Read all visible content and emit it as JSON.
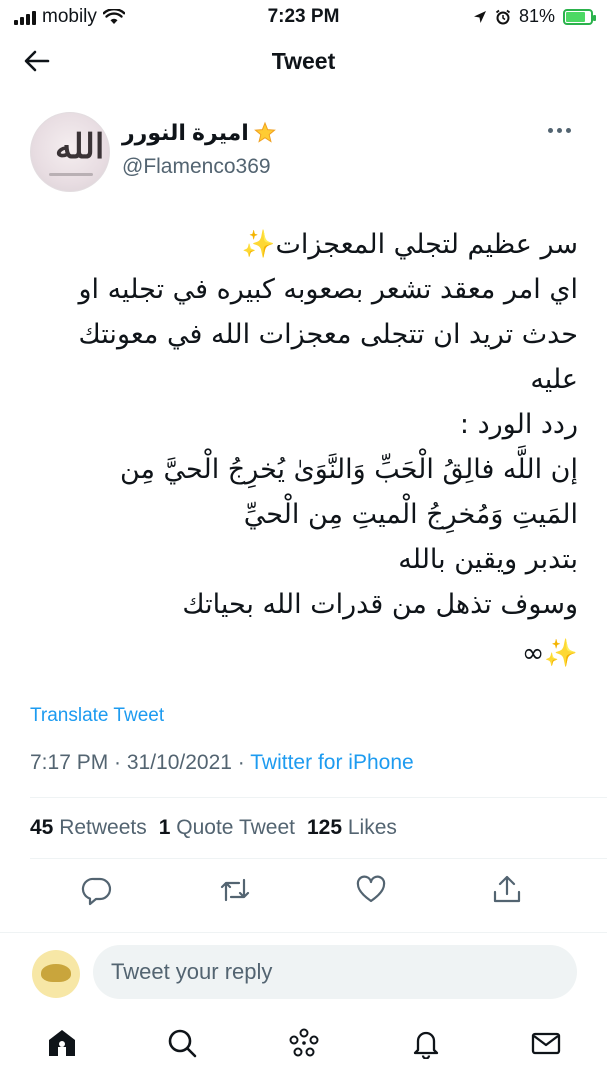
{
  "status": {
    "carrier": "mobily",
    "time": "7:23 PM",
    "battery": "81%",
    "battery_level": 0.81
  },
  "header": {
    "title": "Tweet"
  },
  "tweet": {
    "author_name": "اميرة النورر",
    "author_handle": "@Flamenco369",
    "lines": [
      "سر عظيم لتجلي المعجزات✨",
      "اي امر معقد تشعر بصعوبه كبيره في تجليه او",
      "حدث تريد ان تتجلى معجزات الله في معونتك",
      "عليه",
      "ردد الورد :",
      "إن اللَّه فالِقُ الْحَبِّ وَالنَّوَىٰ يُخرِجُ الْحيَّ مِن",
      "المَيتِ وَمُخرِجُ الْميتِ مِن الْحيِّ",
      "بتدبر ويقين بالله",
      "وسوف تذهل من قدرات الله بحياتك",
      "✨∞"
    ],
    "translate_label": "Translate Tweet",
    "timestamp": "7:17 PM · 31/10/2021 · ",
    "source": "Twitter for iPhone"
  },
  "stats": {
    "retweets_count": "45",
    "retweets_label": "Retweets",
    "quotes_count": "1",
    "quotes_label": "Quote Tweet",
    "likes_count": "125",
    "likes_label": "Likes"
  },
  "reply": {
    "placeholder": "Tweet your reply"
  },
  "icons": {
    "actions": [
      "reply-icon",
      "retweet-icon",
      "like-icon",
      "share-icon"
    ],
    "tabs": [
      "home-icon",
      "search-icon",
      "spaces-icon",
      "notifications-icon",
      "messages-icon"
    ]
  },
  "colors": {
    "accent": "#1d9bf0",
    "secondary_text": "#536471",
    "primary_text": "#0f1419",
    "battery_green": "#4cd964"
  }
}
